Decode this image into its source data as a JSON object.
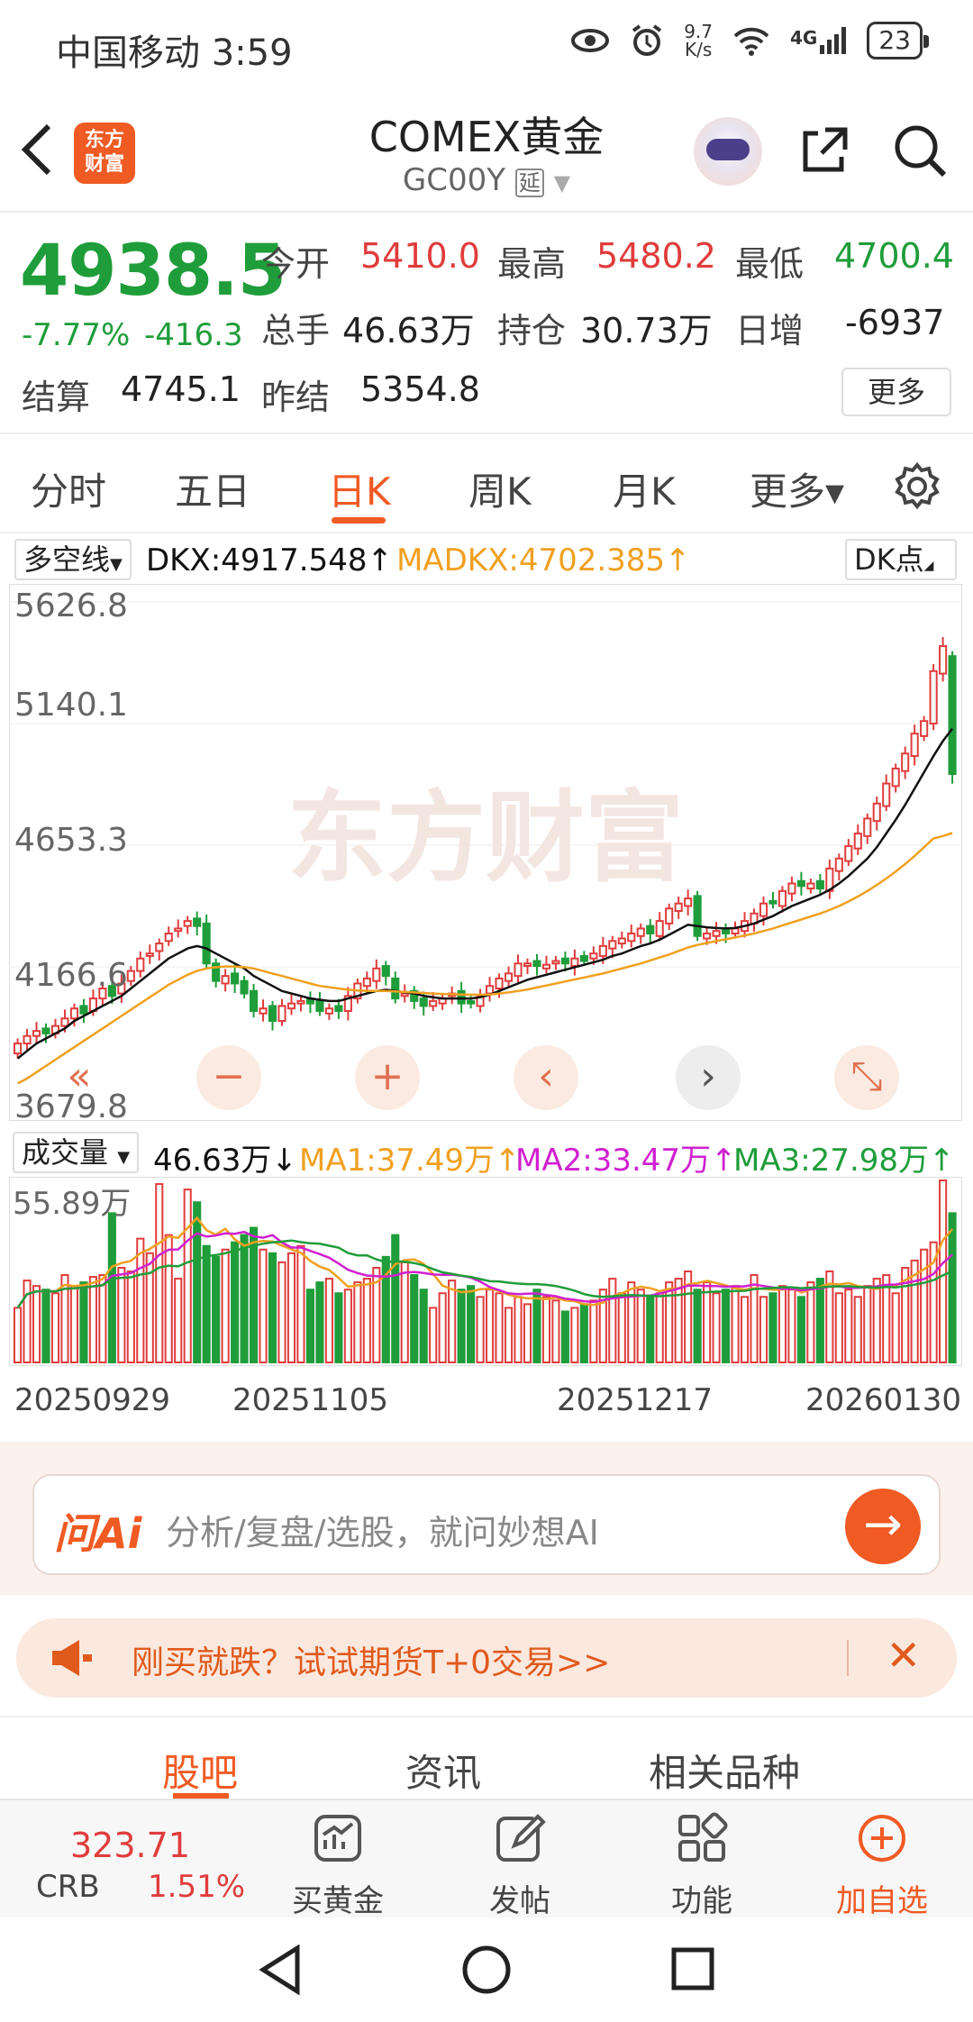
{
  "status": {
    "carrier": "中国移动 3:59",
    "net_speed_top": "9.7",
    "net_speed_unit": "K/s",
    "net_type": "4G",
    "battery": "23"
  },
  "header": {
    "title": "COMEX黄金",
    "code": "GC00Y",
    "delay_badge": "延",
    "logo_text": "东方财富"
  },
  "quote": {
    "price": "4938.5",
    "pct": "-7.77%",
    "change": "-416.3",
    "open_label": "今开",
    "open": "5410.0",
    "high_label": "最高",
    "high": "5480.2",
    "low_label": "最低",
    "low": "4700.4",
    "volume_label": "总手",
    "volume": "46.63万",
    "oi_label": "持仓",
    "oi": "30.73万",
    "daily_inc_label": "日增",
    "daily_inc": "-6937",
    "settle_label": "结算",
    "settle": "4745.1",
    "prev_settle_label": "昨结",
    "prev_settle": "5354.8",
    "more": "更多"
  },
  "tabs": [
    {
      "label": "分时"
    },
    {
      "label": "五日"
    },
    {
      "label": "日K"
    },
    {
      "label": "周K"
    },
    {
      "label": "月K"
    },
    {
      "label": "更多▾"
    }
  ],
  "indicator": {
    "name": "多空线",
    "dkx": "DKX:4917.548↑",
    "madkx": "MADKX:4702.385↑",
    "dk_points": "DK点"
  },
  "volume_indicator": {
    "name": "成交量",
    "value": "46.63万↓",
    "ma1": "MA1:37.49万↑",
    "ma2": "MA2:33.47万↑",
    "ma3": "MA3:27.98万↑"
  },
  "colors": {
    "up": "#e03c3c",
    "down": "#1f9d3a",
    "accent": "#f05a23",
    "dkx": "#111111",
    "madkx": "#f0a020",
    "ma2": "#d020d0",
    "watermark": "#f3e6e0"
  },
  "chart_data": {
    "type": "candlestick",
    "ylabels": [
      "5626.8",
      "5140.1",
      "4653.3",
      "4166.6",
      "3679.8"
    ],
    "ylim": [
      3679.8,
      5626.8
    ],
    "volume_max_label": "55.89万",
    "dates": [
      "20250929",
      "20251105",
      "20251217",
      "20260130"
    ],
    "watermark": "东方财富",
    "close": [
      3860,
      3890,
      3910,
      3900,
      3930,
      3960,
      4000,
      3980,
      4040,
      4080,
      4050,
      4100,
      4150,
      4200,
      4220,
      4260,
      4300,
      4320,
      4350,
      4330,
      4180,
      4110,
      4130,
      4100,
      4060,
      3990,
      4000,
      3950,
      4010,
      4020,
      4030,
      4020,
      3990,
      4000,
      3990,
      4050,
      4100,
      4120,
      4160,
      4130,
      4040,
      4060,
      4030,
      4010,
      4030,
      4040,
      4060,
      4020,
      4020,
      4050,
      4090,
      4120,
      4140,
      4180,
      4180,
      4170,
      4175,
      4190,
      4180,
      4200,
      4190,
      4220,
      4250,
      4270,
      4280,
      4300,
      4320,
      4300,
      4350,
      4400,
      4420,
      4440,
      4290,
      4300,
      4310,
      4300,
      4320,
      4350,
      4380,
      4420,
      4420,
      4470,
      4500,
      4490,
      4500,
      4480,
      4560,
      4600,
      4650,
      4700,
      4760,
      4820,
      4900,
      4960,
      5020,
      5100,
      5150,
      5350,
      5450,
      4938
    ],
    "open": [
      3820,
      3860,
      3890,
      3920,
      3900,
      3930,
      3960,
      4010,
      3990,
      4040,
      4090,
      4060,
      4110,
      4150,
      4210,
      4230,
      4270,
      4310,
      4330,
      4360,
      4340,
      4180,
      4100,
      4140,
      4110,
      4070,
      3980,
      4010,
      3950,
      4000,
      4020,
      4040,
      4030,
      3980,
      4010,
      3990,
      4040,
      4090,
      4110,
      4170,
      4120,
      4050,
      4070,
      4040,
      4010,
      4020,
      4050,
      4070,
      4030,
      4010,
      4060,
      4080,
      4110,
      4130,
      4170,
      4190,
      4160,
      4180,
      4200,
      4170,
      4210,
      4200,
      4210,
      4240,
      4260,
      4270,
      4290,
      4330,
      4290,
      4340,
      4390,
      4410,
      4450,
      4280,
      4290,
      4320,
      4300,
      4310,
      4340,
      4370,
      4430,
      4410,
      4460,
      4510,
      4480,
      4510,
      4470,
      4550,
      4590,
      4640,
      4690,
      4750,
      4810,
      4890,
      4950,
      5010,
      5090,
      5140,
      5340,
      5410
    ],
    "volume": [
      0.3,
      0.45,
      0.42,
      0.4,
      0.38,
      0.48,
      0.42,
      0.44,
      0.47,
      0.48,
      0.82,
      0.52,
      0.5,
      0.68,
      0.6,
      0.98,
      0.7,
      0.46,
      0.95,
      0.88,
      0.64,
      0.58,
      0.62,
      0.66,
      0.7,
      0.74,
      0.62,
      0.6,
      0.55,
      0.6,
      0.64,
      0.4,
      0.44,
      0.46,
      0.38,
      0.4,
      0.44,
      0.46,
      0.52,
      0.58,
      0.7,
      0.55,
      0.48,
      0.4,
      0.3,
      0.38,
      0.45,
      0.4,
      0.42,
      0.36,
      0.4,
      0.38,
      0.3,
      0.36,
      0.32,
      0.4,
      0.36,
      0.34,
      0.28,
      0.3,
      0.32,
      0.34,
      0.4,
      0.46,
      0.38,
      0.44,
      0.4,
      0.36,
      0.38,
      0.44,
      0.46,
      0.5,
      0.4,
      0.44,
      0.38,
      0.4,
      0.42,
      0.36,
      0.48,
      0.36,
      0.38,
      0.42,
      0.4,
      0.36,
      0.44,
      0.46,
      0.5,
      0.38,
      0.4,
      0.36,
      0.42,
      0.46,
      0.48,
      0.38,
      0.52,
      0.56,
      0.62,
      0.66,
      1.0,
      0.82
    ],
    "dkx": [
      3800,
      3830,
      3860,
      3880,
      3900,
      3920,
      3950,
      3970,
      3990,
      4010,
      4030,
      4050,
      4080,
      4110,
      4140,
      4170,
      4200,
      4220,
      4240,
      4250,
      4240,
      4220,
      4200,
      4180,
      4160,
      4130,
      4110,
      4090,
      4070,
      4060,
      4050,
      4040,
      4035,
      4030,
      4030,
      4040,
      4050,
      4060,
      4070,
      4075,
      4070,
      4065,
      4060,
      4050,
      4045,
      4040,
      4040,
      4040,
      4040,
      4045,
      4055,
      4070,
      4085,
      4100,
      4115,
      4125,
      4135,
      4145,
      4155,
      4165,
      4175,
      4185,
      4195,
      4210,
      4220,
      4235,
      4250,
      4260,
      4275,
      4295,
      4315,
      4335,
      4330,
      4325,
      4322,
      4320,
      4322,
      4330,
      4340,
      4355,
      4370,
      4390,
      4410,
      4425,
      4440,
      4455,
      4475,
      4500,
      4530,
      4565,
      4600,
      4645,
      4700,
      4755,
      4815,
      4880,
      4945,
      5010,
      5070,
      5120
    ],
    "madkx": [
      3700,
      3720,
      3745,
      3770,
      3795,
      3820,
      3845,
      3870,
      3895,
      3920,
      3945,
      3970,
      3995,
      4020,
      4045,
      4070,
      4095,
      4115,
      4135,
      4150,
      4160,
      4165,
      4168,
      4168,
      4165,
      4160,
      4150,
      4140,
      4130,
      4120,
      4110,
      4100,
      4090,
      4085,
      4080,
      4075,
      4072,
      4070,
      4070,
      4070,
      4068,
      4066,
      4064,
      4062,
      4060,
      4058,
      4057,
      4056,
      4055,
      4055,
      4056,
      4060,
      4064,
      4070,
      4076,
      4084,
      4092,
      4100,
      4108,
      4116,
      4124,
      4132,
      4140,
      4150,
      4160,
      4170,
      4180,
      4192,
      4204,
      4216,
      4230,
      4244,
      4254,
      4262,
      4270,
      4277,
      4284,
      4292,
      4300,
      4310,
      4320,
      4332,
      4344,
      4356,
      4368,
      4380,
      4394,
      4410,
      4428,
      4448,
      4470,
      4494,
      4520,
      4548,
      4578,
      4610,
      4645,
      4680,
      4690,
      4702
    ]
  },
  "ai": {
    "logo": "问Ai",
    "placeholder": "分析/复盘/选股，就问妙想AI"
  },
  "promo": {
    "text": "刚买就跌？试试期货T+0交易>>"
  },
  "subtabs": [
    {
      "label": "股吧"
    },
    {
      "label": "资讯"
    },
    {
      "label": "相关品种"
    }
  ],
  "bottom": {
    "crb_value": "323.71",
    "crb_name": "CRB",
    "crb_pct": "1.51%",
    "items": [
      {
        "label": "买黄金"
      },
      {
        "label": "发帖"
      },
      {
        "label": "功能"
      },
      {
        "label": "加自选"
      }
    ]
  }
}
